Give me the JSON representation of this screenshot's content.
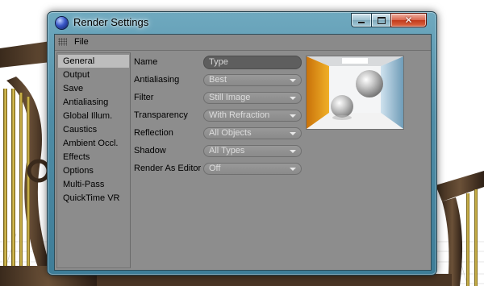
{
  "window": {
    "title": "Render Settings"
  },
  "menu": {
    "file": "File"
  },
  "sidebar": {
    "items": [
      {
        "label": "General",
        "active": true
      },
      {
        "label": "Output"
      },
      {
        "label": "Save"
      },
      {
        "label": "Antialiasing"
      },
      {
        "label": "Global Illum."
      },
      {
        "label": "Caustics"
      },
      {
        "label": "Ambient Occl."
      },
      {
        "label": "Effects"
      },
      {
        "label": "Options"
      },
      {
        "label": "Multi-Pass"
      },
      {
        "label": "QuickTime VR"
      }
    ]
  },
  "general": {
    "name": {
      "label": "Name",
      "value": "Type"
    },
    "antialiasing": {
      "label": "Antialiasing",
      "value": "Best"
    },
    "filter": {
      "label": "Filter",
      "value": "Still Image"
    },
    "transparency": {
      "label": "Transparency",
      "value": "With Refraction"
    },
    "reflection": {
      "label": "Reflection",
      "value": "All Objects"
    },
    "shadow": {
      "label": "Shadow",
      "value": "All Types"
    },
    "render_as_editor": {
      "label": "Render As Editor",
      "value": "Off"
    }
  },
  "colors": {
    "panel_bg": "#8d8d8d",
    "active_item_bg": "#bdbdbd",
    "window_frame": "#4f8da6",
    "close_button": "#c23a1b"
  }
}
